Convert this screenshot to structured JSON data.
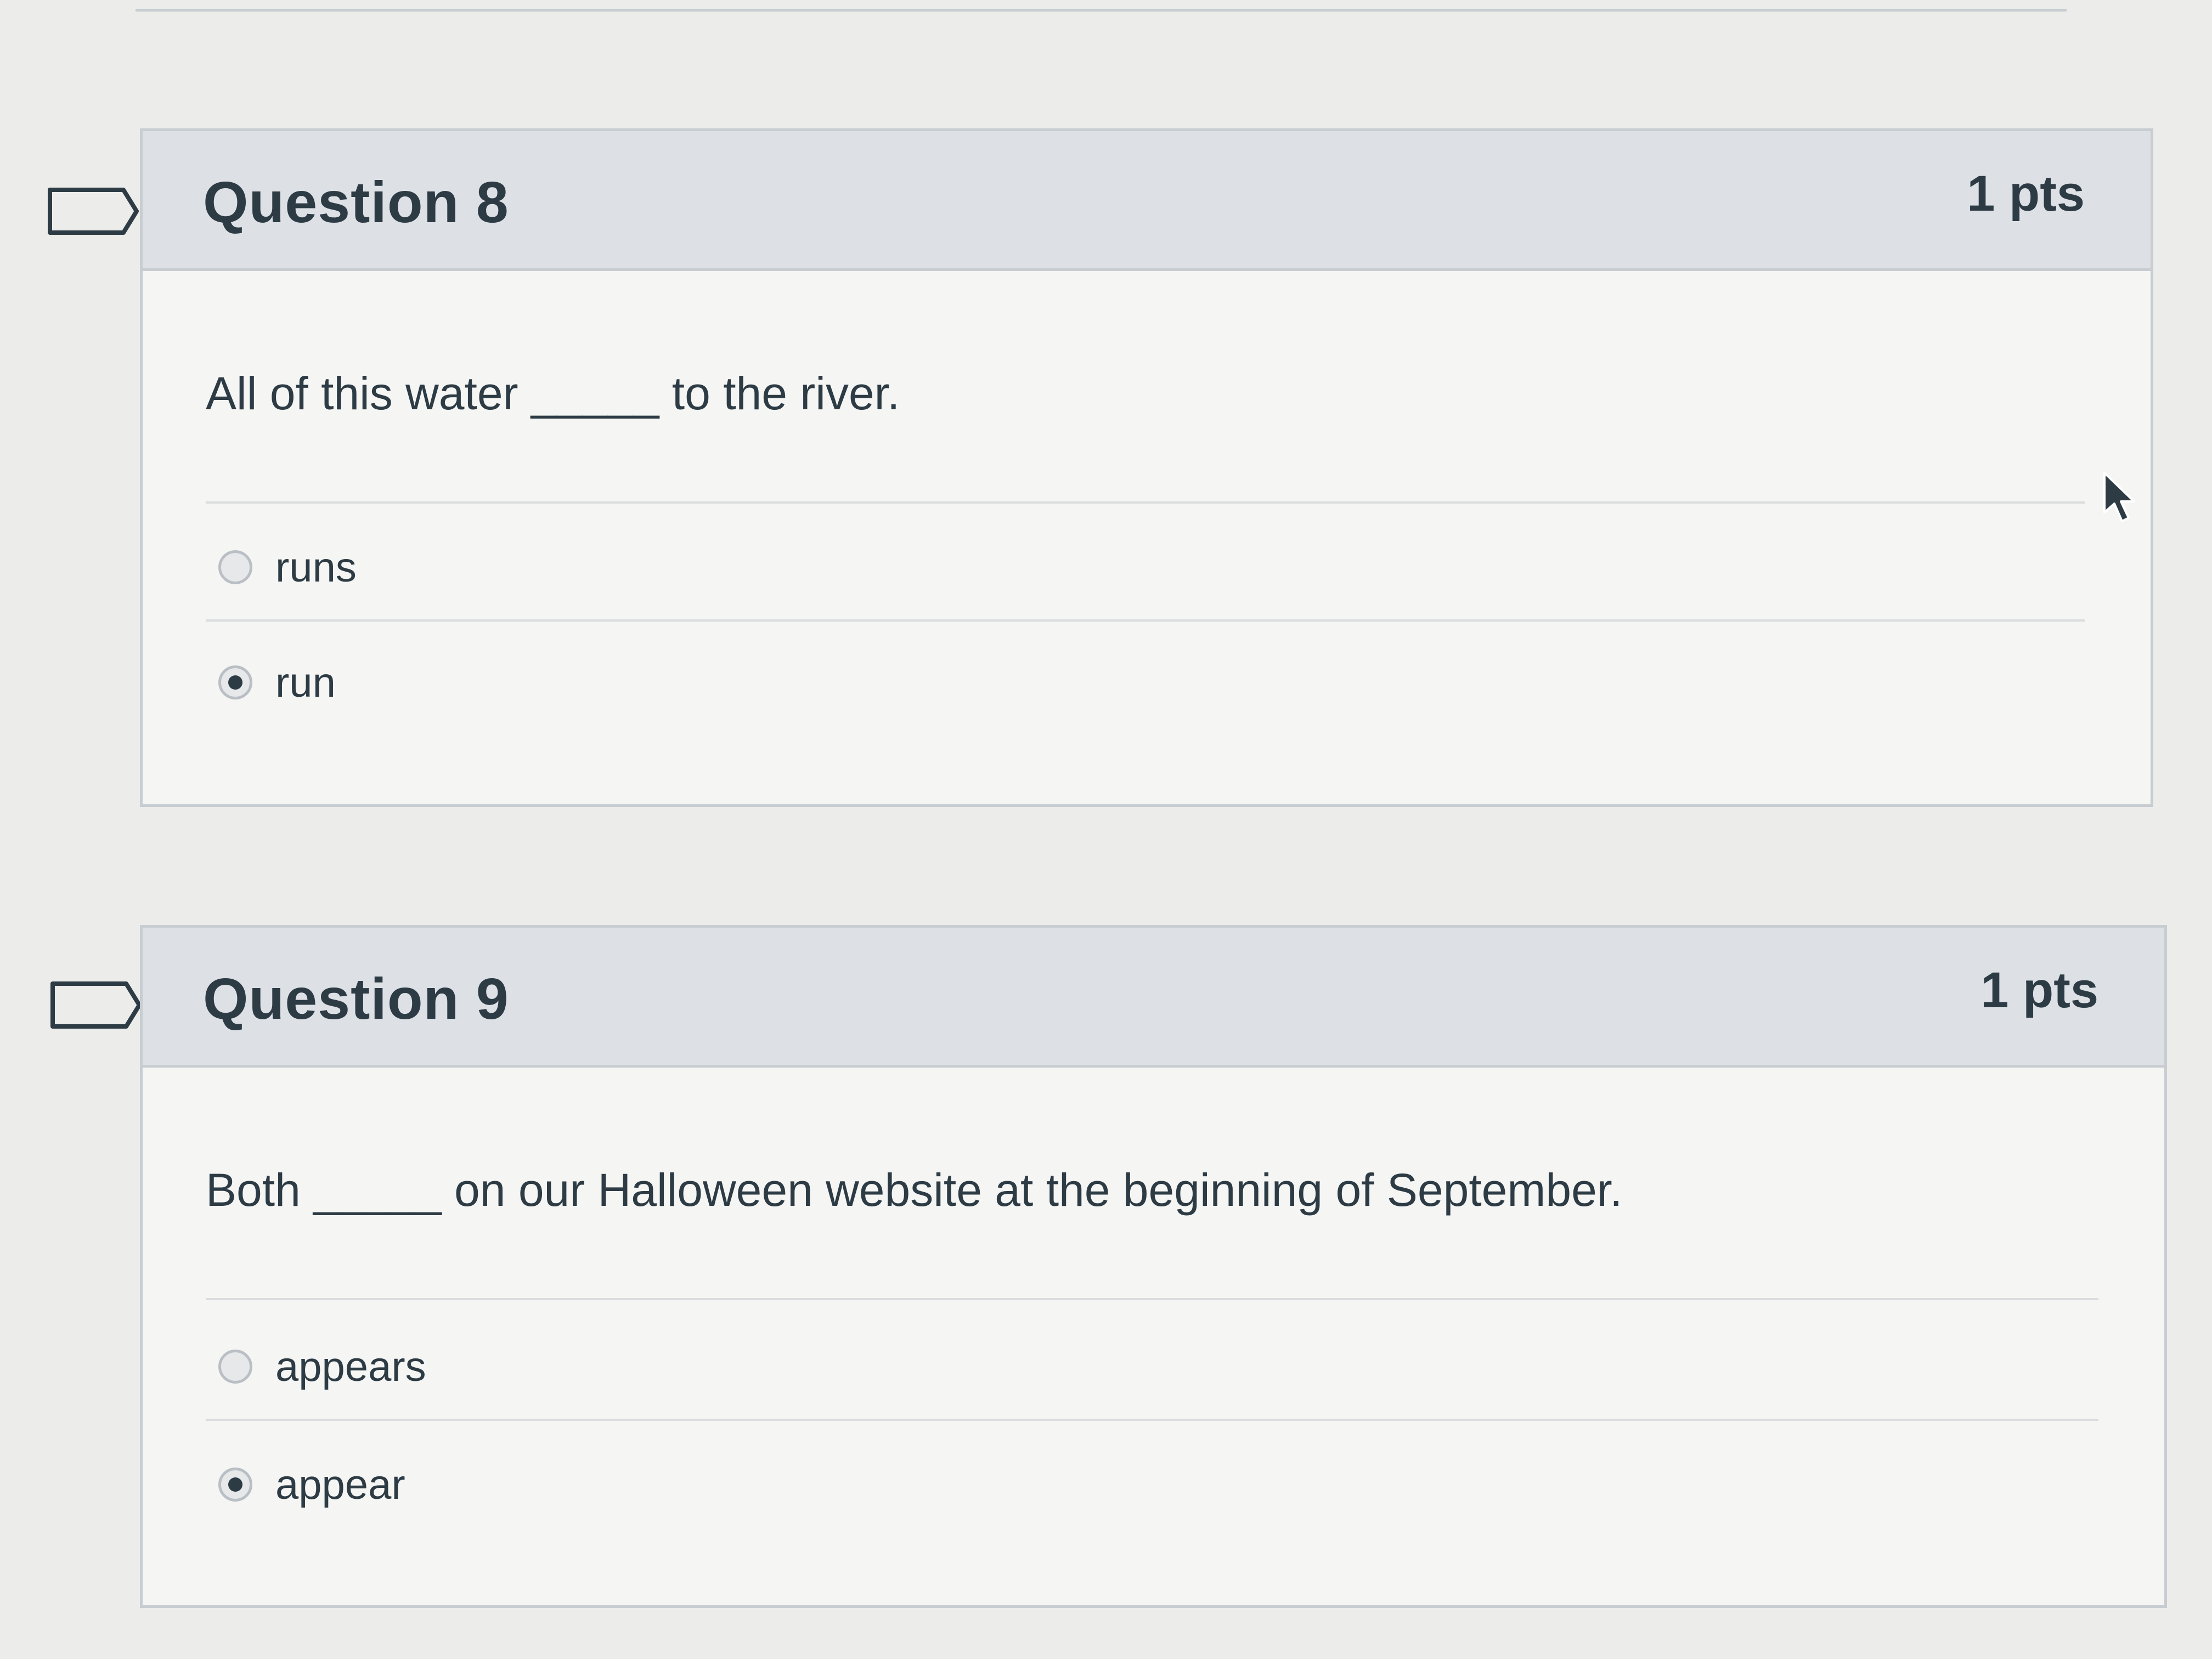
{
  "questions": [
    {
      "title": "Question 8",
      "points": "1 pts",
      "text": "All of this water _____ to the river.",
      "answers": [
        {
          "label": "runs",
          "selected": false
        },
        {
          "label": "run",
          "selected": true
        }
      ]
    },
    {
      "title": "Question 9",
      "points": "1 pts",
      "text": "Both _____ on our Halloween website at the beginning of September.",
      "answers": [
        {
          "label": "appears",
          "selected": false
        },
        {
          "label": "appear",
          "selected": true
        }
      ]
    }
  ],
  "colors": {
    "background": "#ececea",
    "header": "#dde0e5",
    "border": "#c7cdd1",
    "text": "#2d3b45"
  },
  "icons": [
    "flag-icon",
    "mouse-cursor-icon"
  ]
}
